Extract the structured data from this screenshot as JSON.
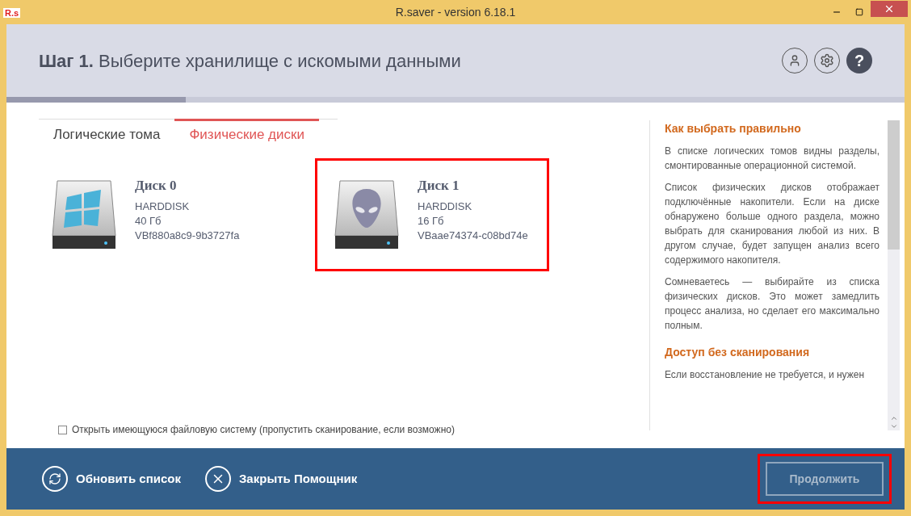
{
  "window": {
    "title": "R.saver - version 6.18.1",
    "app_badge": "R.s"
  },
  "header": {
    "step": "Шаг 1.",
    "title": "Выберите хранилище с искомыми данными",
    "help_label": "?"
  },
  "progress": {
    "level": 0.2
  },
  "tabs": [
    {
      "label": "Логические тома",
      "selected": false
    },
    {
      "label": "Физические диски",
      "selected": true
    }
  ],
  "disks": [
    {
      "name": "Диск 0",
      "kind": "windows",
      "type": "HARDDISK",
      "size": "40 Гб",
      "id": "VBf880a8c9-9b3727fa",
      "highlighted": false
    },
    {
      "name": "Диск 1",
      "kind": "alien",
      "type": "HARDDISK",
      "size": "16 Гб",
      "id": "VBaae74374-c08bd74e",
      "highlighted": true
    }
  ],
  "help": {
    "sections": [
      {
        "heading": "Как выбрать правильно",
        "paragraphs": [
          "В списке логических томов видны разделы, смонтированные операционной системой.",
          "Список физических дисков отображает подключённые накопители. Если на диске обнаружено больше одного раздела, можно выбрать для сканирования любой из них. В другом случае, будет запущен анализ всего содержимого накопителя.",
          "Сомневаетесь — выбирайте из списка физических дисков. Это может замедлить процесс анализа, но сделает его максимально полным."
        ]
      },
      {
        "heading": "Доступ без сканирования",
        "paragraphs": [
          "Если восстановление не требуется, и нужен"
        ]
      }
    ]
  },
  "option": {
    "label": "Открыть имеющуюся файловую систему (пропустить сканирование, если возможно)",
    "checked": false
  },
  "footer": {
    "refresh": "Обновить список",
    "close": "Закрыть Помощник",
    "continue": {
      "label": "Продолжить",
      "disabled": true,
      "highlighted": true
    }
  }
}
